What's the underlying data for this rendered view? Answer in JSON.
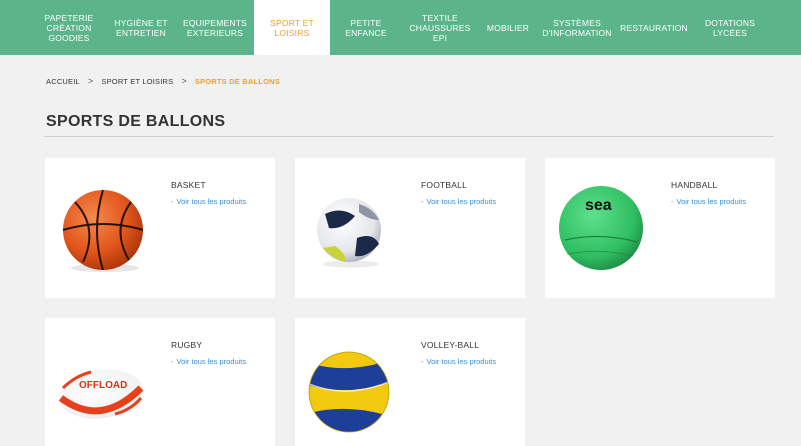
{
  "nav": {
    "items": [
      {
        "label": "PAPETERIE\nCRÉATION\nGOODIES",
        "active": false
      },
      {
        "label": "HYGIÈNE ET\nENTRETIEN",
        "active": false
      },
      {
        "label": "EQUIPEMENTS\nEXTERIEURS",
        "active": false
      },
      {
        "label": "SPORT ET\nLOISIRS",
        "active": true
      },
      {
        "label": "PETITE\nENFANCE",
        "active": false
      },
      {
        "label": "TEXTILE\nCHAUSSURES\nEPI",
        "active": false
      },
      {
        "label": "MOBILIER",
        "active": false
      },
      {
        "label": "SYSTÈMES\nD'INFORMATION",
        "active": false
      },
      {
        "label": "RESTAURATION",
        "active": false
      },
      {
        "label": "DOTATIONS\nLYCÉES",
        "active": false
      }
    ]
  },
  "breadcrumb": {
    "items": [
      "ACCUEIL",
      "SPORT ET LOISIRS",
      "SPORTS DE BALLONS"
    ],
    "separator": ">"
  },
  "page": {
    "title": "SPORTS DE BALLONS"
  },
  "products": [
    {
      "title": "BASKET",
      "link": "Voir tous les produits",
      "icon": "basketball-icon"
    },
    {
      "title": "FOOTBALL",
      "link": "Voir tous les produits",
      "icon": "football-icon"
    },
    {
      "title": "HANDBALL",
      "link": "Voir tous les produits",
      "icon": "handball-icon",
      "ball_text": "sea"
    },
    {
      "title": "RUGBY",
      "link": "Voir tous les produits",
      "icon": "rugby-ball-icon",
      "ball_text": "OFFLOAD"
    },
    {
      "title": "VOLLEY-BALL",
      "link": "Voir tous les produits",
      "icon": "volleyball-icon"
    }
  ],
  "colors": {
    "nav_green": "#5cb58a",
    "accent_orange": "#f0a02a",
    "link_blue": "#3b8fd4",
    "page_bg": "#f1f1f1"
  }
}
